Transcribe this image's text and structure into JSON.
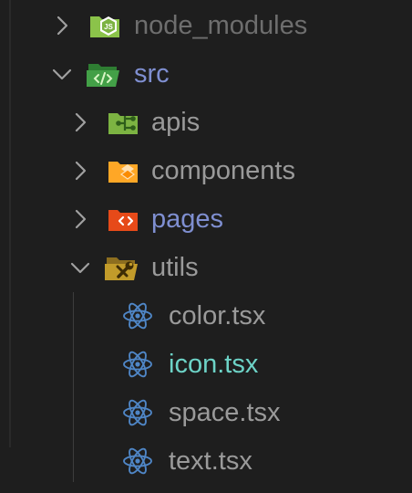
{
  "colors": {
    "background": "#1e1e1e",
    "text_default": "#9a9a9a",
    "text_folder_open": "#7f8fd1",
    "text_active_file": "#6dd3c7",
    "react_icon": "#4f86c6",
    "chevron": "#a0a0a0"
  },
  "tree": [
    {
      "label": "node_modules",
      "kind": "folder",
      "expanded": false,
      "icon": "nodejs-folder-icon"
    },
    {
      "label": "src",
      "kind": "folder",
      "expanded": true,
      "icon": "src-folder-icon"
    },
    {
      "label": "apis",
      "kind": "folder",
      "expanded": false,
      "icon": "api-folder-icon"
    },
    {
      "label": "components",
      "kind": "folder",
      "expanded": false,
      "icon": "components-folder-icon"
    },
    {
      "label": "pages",
      "kind": "folder",
      "expanded": false,
      "icon": "pages-folder-icon"
    },
    {
      "label": "utils",
      "kind": "folder",
      "expanded": true,
      "icon": "utils-folder-icon"
    },
    {
      "label": "color.tsx",
      "kind": "file",
      "icon": "react-icon"
    },
    {
      "label": "icon.tsx",
      "kind": "file",
      "icon": "react-icon",
      "active": true
    },
    {
      "label": "space.tsx",
      "kind": "file",
      "icon": "react-icon"
    },
    {
      "label": "text.tsx",
      "kind": "file",
      "icon": "react-icon"
    }
  ]
}
